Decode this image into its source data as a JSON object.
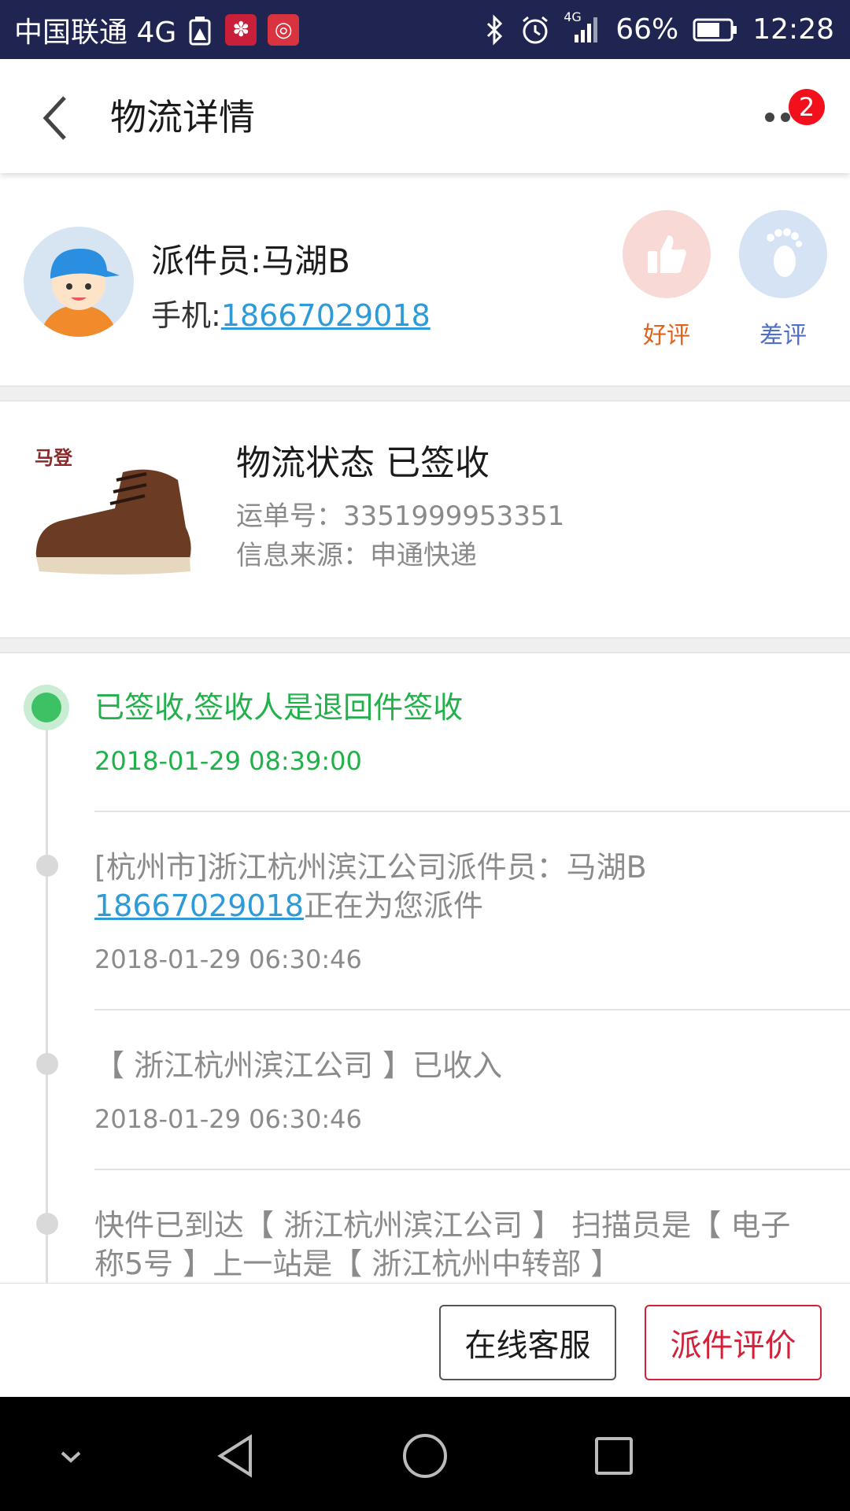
{
  "status_bar": {
    "carrier": "中国联通 4G",
    "battery": "66%",
    "time": "12:28",
    "network_label": "4G",
    "icons": [
      "warning-icon",
      "app-icon-1",
      "app-icon-2",
      "bluetooth-icon",
      "alarm-icon",
      "signal-icon",
      "battery-icon"
    ]
  },
  "header": {
    "title": "物流详情",
    "notification_count": "2"
  },
  "courier": {
    "name": "派件员:马湖B",
    "phone_label": "手机:",
    "phone": "18667029018",
    "good_label": "好评",
    "bad_label": "差评"
  },
  "package": {
    "brand": "马登",
    "status": "物流状态 已签收",
    "waybill": "运单号：3351999953351",
    "source": "信息来源：申通快递"
  },
  "timeline": [
    {
      "text": "已签收,签收人是退回件签收",
      "time": "2018-01-29 08:39:00",
      "active": true
    },
    {
      "text_prefix": "[杭州市]浙江杭州滨江公司派件员：马湖B",
      "phone": "18667029018",
      "text_suffix": "正在为您派件",
      "time": "2018-01-29 06:30:46"
    },
    {
      "text": "【 浙江杭州滨江公司 】已收入",
      "time": "2018-01-29 06:30:46"
    },
    {
      "text": "快件已到达【 浙江杭州滨江公司 】 扫描员是【 电子称5号 】上一站是【 浙江杭州中转部 】"
    }
  ],
  "actions": {
    "service": "在线客服",
    "rate": "派件评价"
  },
  "colors": {
    "status_bar": "#1f2550",
    "accent_green": "#22b04b",
    "link_blue": "#2e9bd8",
    "rate_red": "#d4213a"
  }
}
